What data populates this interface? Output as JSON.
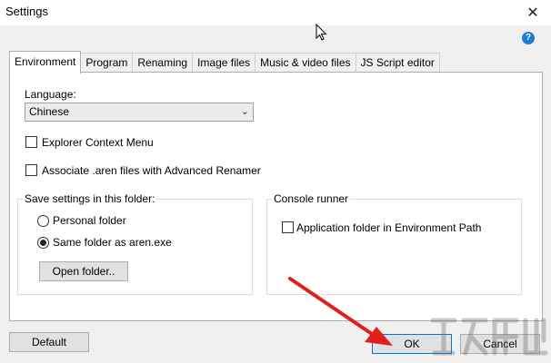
{
  "window": {
    "title": "Settings",
    "close_glyph": "✕"
  },
  "help": {
    "glyph": "?",
    "icon": "help-icon"
  },
  "tabs": [
    {
      "label": "Environment",
      "active": true
    },
    {
      "label": "Program"
    },
    {
      "label": "Renaming"
    },
    {
      "label": "Image files"
    },
    {
      "label": "Music & video files"
    },
    {
      "label": "JS Script editor"
    }
  ],
  "environment": {
    "language_label": "Language:",
    "language_value": "Chinese",
    "explorer_context_menu": "Explorer Context Menu",
    "associate_aren": "Associate .aren files with Advanced Renamer",
    "save_settings": {
      "title": "Save settings in this folder:",
      "personal_folder": "Personal folder",
      "same_folder": "Same folder as aren.exe",
      "open_folder_button": "Open folder.."
    },
    "console_runner": {
      "title": "Console runner",
      "app_folder_env_path": "Application folder in Environment Path"
    }
  },
  "footer": {
    "default_button": "Default",
    "ok_button": "OK",
    "cancel_button": "Cancel"
  },
  "colors": {
    "accent": "#0078d7",
    "annotation_arrow": "#e0201c",
    "help": "#1c7fd6"
  }
}
